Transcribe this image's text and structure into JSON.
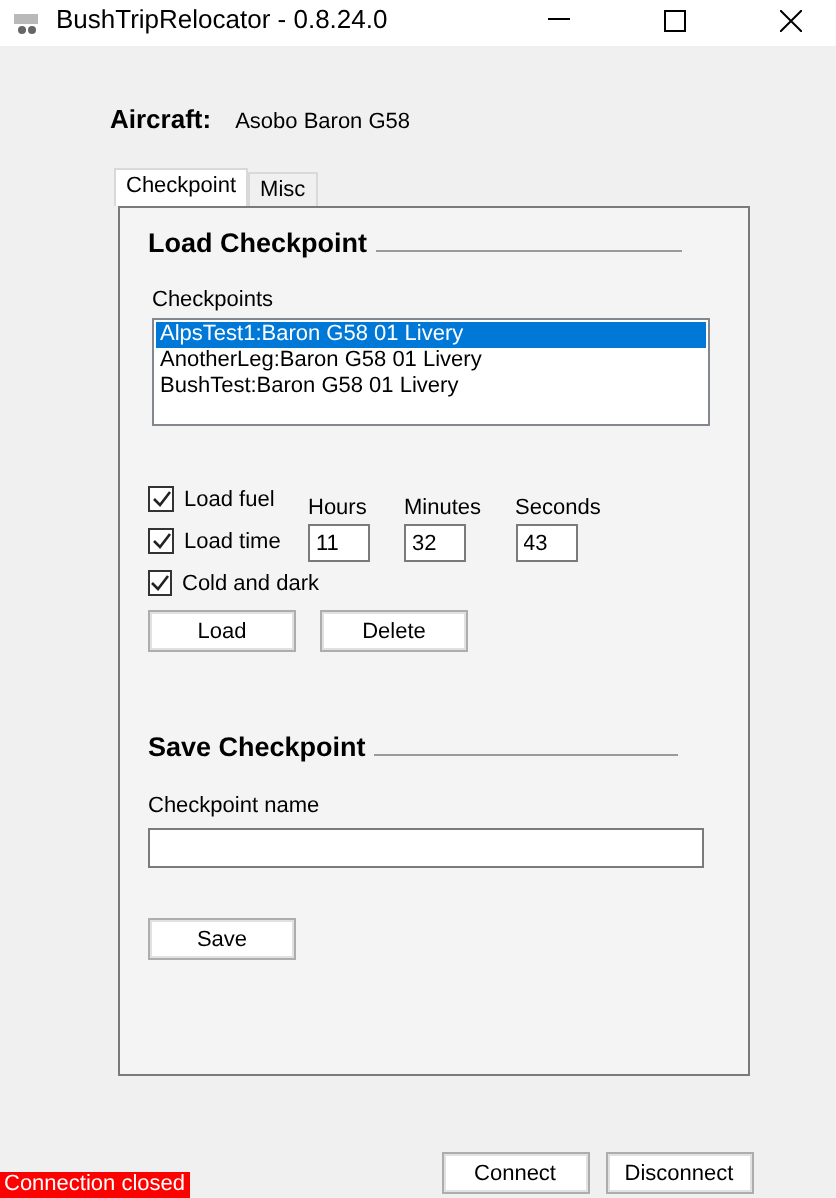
{
  "window": {
    "title": "BushTripRelocator - 0.8.24.0"
  },
  "aircraft": {
    "label": "Aircraft:",
    "value": "Asobo Baron G58"
  },
  "tabs": [
    {
      "label": "Checkpoint",
      "selected": true
    },
    {
      "label": "Misc",
      "selected": false
    }
  ],
  "load_checkpoint": {
    "heading": "Load Checkpoint",
    "list_label": "Checkpoints",
    "checkpoints": [
      {
        "label": "AlpsTest1:Baron G58 01 Livery",
        "selected": true
      },
      {
        "label": "AnotherLeg:Baron G58 01 Livery",
        "selected": false
      },
      {
        "label": "BushTest:Baron G58 01 Livery",
        "selected": false
      }
    ],
    "options": [
      {
        "label": "Load fuel",
        "checked": true
      },
      {
        "label": "Load time",
        "checked": true
      },
      {
        "label": "Cold and dark",
        "checked": true
      }
    ],
    "time_fields": [
      {
        "label": "Hours",
        "value": "11"
      },
      {
        "label": "Minutes",
        "value": "32"
      },
      {
        "label": "Seconds",
        "value": "43"
      }
    ],
    "buttons": [
      "Load",
      "Delete"
    ]
  },
  "save_checkpoint": {
    "heading": "Save Checkpoint",
    "name_label": "Checkpoint name",
    "button": "Save"
  },
  "status": "Connection closed",
  "footer_buttons": [
    "Connect",
    "Disconnect"
  ]
}
